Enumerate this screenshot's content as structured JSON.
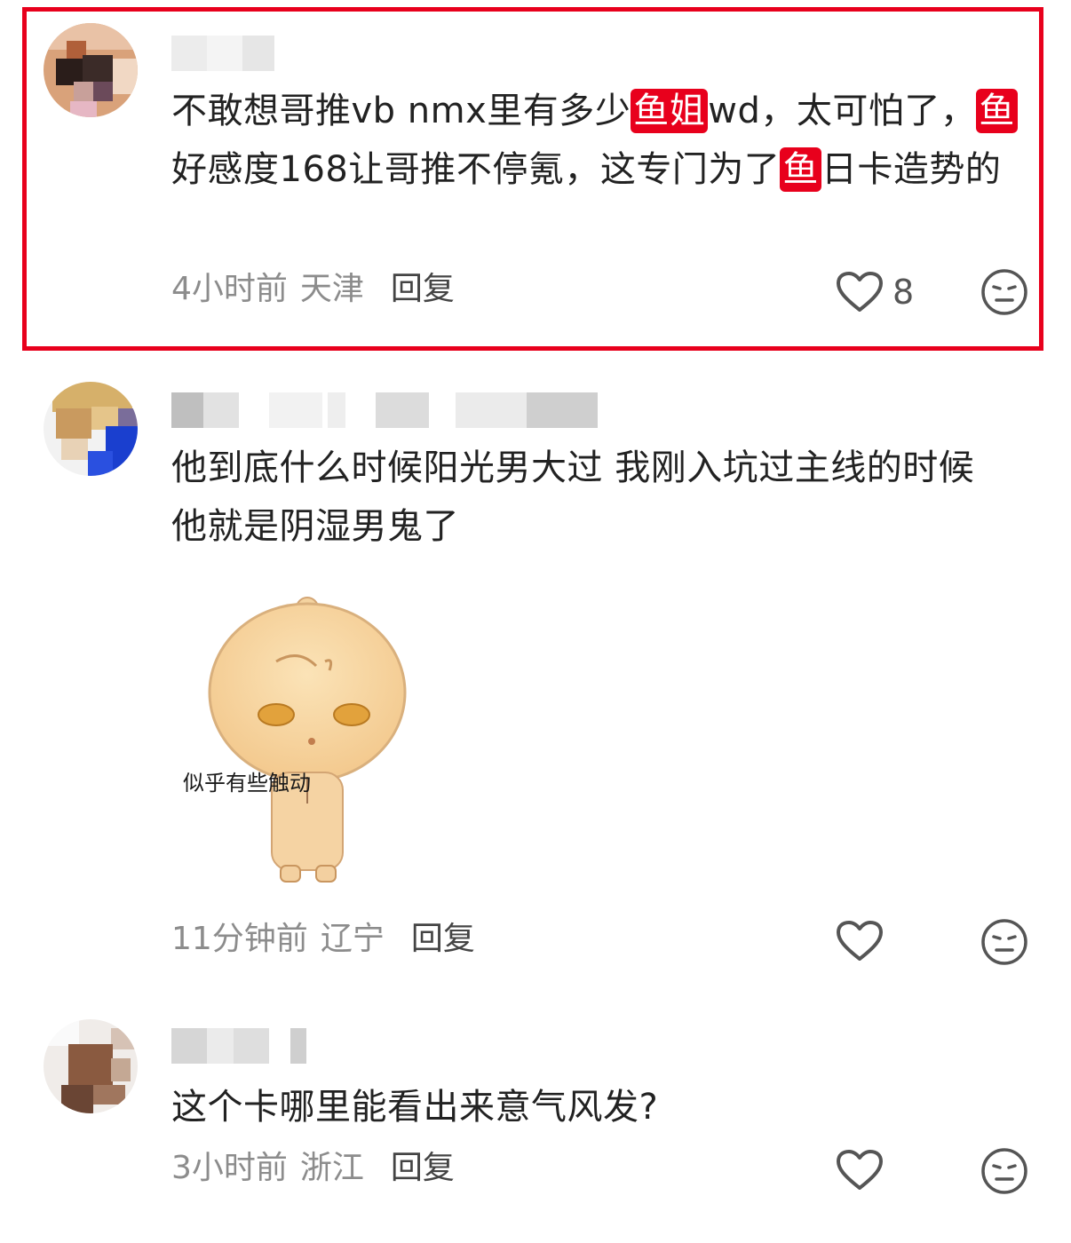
{
  "comments": [
    {
      "segments": [
        {
          "text": "不敢想哥推vb nmx里有多少",
          "mark": false
        },
        {
          "text": "鱼姐",
          "mark": true
        },
        {
          "text": "wd，太可怕了，",
          "mark": false
        },
        {
          "text": "鱼",
          "mark": true
        },
        {
          "text": "好感度168让哥推不停氪，这专门为了",
          "mark": false
        },
        {
          "text": "鱼",
          "mark": true
        },
        {
          "text": "日卡造势的",
          "mark": false
        }
      ],
      "time": "4小时前",
      "location": "天津",
      "reply": "回复",
      "likes": "8",
      "highlighted": true
    },
    {
      "text": "他到底什么时候阳光男大过 我刚入坑过主线的时候他就是阴湿男鬼了",
      "sticker_caption": "似乎有些触动",
      "time": "11分钟前",
      "location": "辽宁",
      "reply": "回复",
      "likes": ""
    },
    {
      "text": "这个卡哪里能看出来意气风发?",
      "time": "3小时前",
      "location": "浙江",
      "reply": "回复",
      "likes": ""
    }
  ],
  "icons": {
    "like": "heart-outline-icon",
    "emoji": "neutral-face-icon"
  },
  "colors": {
    "highlight_border": "#e8001c",
    "mark_background": "#e8001c",
    "meta_text": "#8c8c8c"
  }
}
